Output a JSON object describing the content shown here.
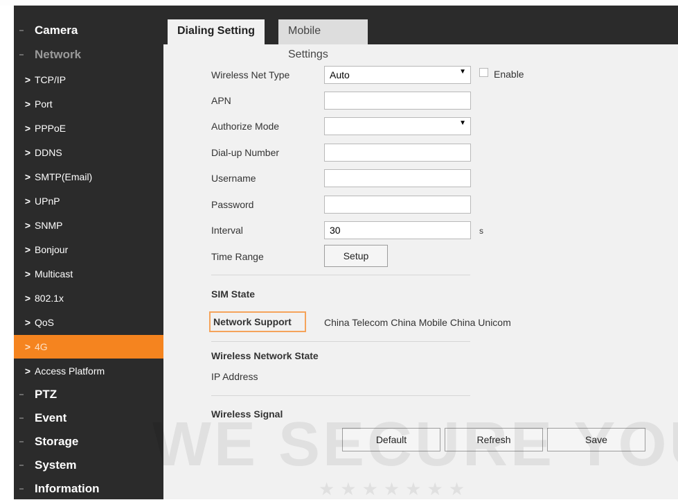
{
  "sidebar": {
    "top_items": [
      {
        "label": "Camera"
      },
      {
        "label": "Network"
      },
      {
        "label": "PTZ"
      },
      {
        "label": "Event"
      },
      {
        "label": "Storage"
      },
      {
        "label": "System"
      },
      {
        "label": "Information"
      }
    ],
    "network_children": [
      {
        "label": "TCP/IP"
      },
      {
        "label": "Port"
      },
      {
        "label": "PPPoE"
      },
      {
        "label": "DDNS"
      },
      {
        "label": "SMTP(Email)"
      },
      {
        "label": "UPnP"
      },
      {
        "label": "SNMP"
      },
      {
        "label": "Bonjour"
      },
      {
        "label": "Multicast"
      },
      {
        "label": "802.1x"
      },
      {
        "label": "QoS"
      },
      {
        "label": "4G"
      },
      {
        "label": "Access Platform"
      }
    ],
    "active_child": "4G",
    "chevron": ">"
  },
  "tabs": [
    {
      "label": "Dialing Setting",
      "active": true
    },
    {
      "label": "Mobile Settings",
      "active": false
    }
  ],
  "form": {
    "wireless_net_type": {
      "label": "Wireless Net Type",
      "value": "Auto"
    },
    "enable": {
      "label": "Enable",
      "checked": false
    },
    "apn": {
      "label": "APN",
      "value": ""
    },
    "authorize_mode": {
      "label": "Authorize Mode",
      "value": ""
    },
    "dialup_number": {
      "label": "Dial-up Number",
      "value": ""
    },
    "username": {
      "label": "Username",
      "value": ""
    },
    "password": {
      "label": "Password",
      "value": ""
    },
    "interval": {
      "label": "Interval",
      "value": "30",
      "unit": "s"
    },
    "time_range": {
      "label": "Time Range",
      "button": "Setup"
    }
  },
  "sim_state": {
    "heading": "SIM State",
    "network_support_label": "Network Support",
    "network_support_value": "China Telecom China Mobile China Unicom"
  },
  "wireless_network_state": {
    "heading": "Wireless Network State",
    "ip_address_label": "IP Address",
    "ip_address_value": ""
  },
  "wireless_signal": {
    "heading": "Wireless Signal"
  },
  "buttons": {
    "default": "Default",
    "refresh": "Refresh",
    "save": "Save"
  },
  "watermark": {
    "text": "WE SECURE YOUR LIFE",
    "stars": "★★★★★★★"
  },
  "colors": {
    "accent": "#f5841f",
    "sidebar_bg": "#2b2b2b",
    "panel_bg": "#f1f1f1"
  }
}
